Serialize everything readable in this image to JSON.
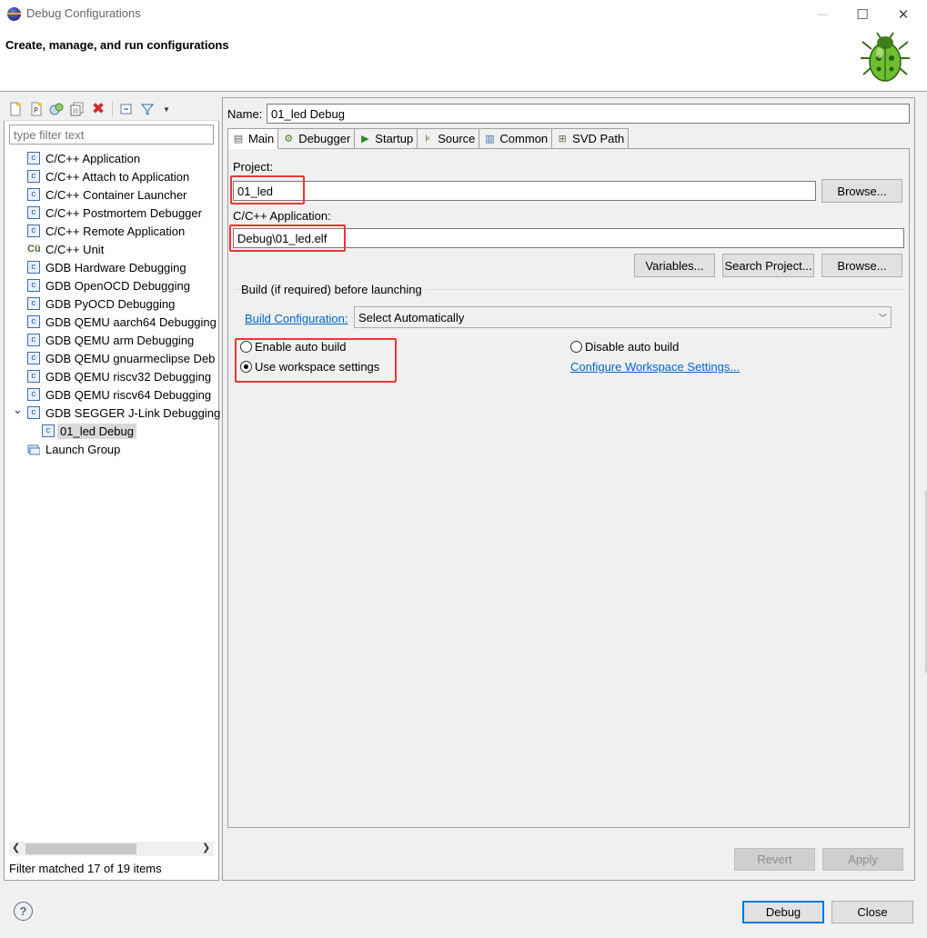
{
  "window": {
    "title": "Debug Configurations",
    "header": "Create, manage, and run configurations",
    "minimize": "—",
    "maximize": "☐",
    "close": "✕"
  },
  "toolbar": {
    "icons": [
      "new-configuration-icon",
      "new-prototype-icon",
      "export-icon",
      "duplicate-icon",
      "delete-icon",
      "collapse-all-icon",
      "filter-icon",
      "view-menu-icon"
    ]
  },
  "filter": {
    "placeholder": "type filter text",
    "status": "Filter matched 17 of 19 items"
  },
  "tree": {
    "items": [
      {
        "label": "C/C++ Application",
        "icon": "c"
      },
      {
        "label": "C/C++ Attach to Application",
        "icon": "c"
      },
      {
        "label": "C/C++ Container Launcher",
        "icon": "c"
      },
      {
        "label": "C/C++ Postmortem Debugger",
        "icon": "c"
      },
      {
        "label": "C/C++ Remote Application",
        "icon": "c"
      },
      {
        "label": "C/C++ Unit",
        "icon": "cu"
      },
      {
        "label": "GDB Hardware Debugging",
        "icon": "c"
      },
      {
        "label": "GDB OpenOCD Debugging",
        "icon": "c"
      },
      {
        "label": "GDB PyOCD Debugging",
        "icon": "c"
      },
      {
        "label": "GDB QEMU aarch64 Debugging",
        "icon": "c"
      },
      {
        "label": "GDB QEMU arm Debugging",
        "icon": "c"
      },
      {
        "label": "GDB QEMU gnuarmeclipse Deb",
        "icon": "c"
      },
      {
        "label": "GDB QEMU riscv32 Debugging",
        "icon": "c"
      },
      {
        "label": "GDB QEMU riscv64 Debugging",
        "icon": "c"
      },
      {
        "label": "GDB SEGGER J-Link Debugging",
        "icon": "c"
      },
      {
        "label": "01_led Debug",
        "icon": "c"
      },
      {
        "label": "Launch Group",
        "icon": "group"
      }
    ]
  },
  "name": {
    "label": "Name:",
    "value": "01_led Debug"
  },
  "tabs": [
    {
      "label": "Main",
      "icon": "main-tab-icon"
    },
    {
      "label": "Debugger",
      "icon": "debugger-tab-icon"
    },
    {
      "label": "Startup",
      "icon": "startup-tab-icon"
    },
    {
      "label": "Source",
      "icon": "source-tab-icon"
    },
    {
      "label": "Common",
      "icon": "common-tab-icon"
    },
    {
      "label": "SVD Path",
      "icon": "svd-path-tab-icon"
    }
  ],
  "main": {
    "project_label": "Project:",
    "project_value": "01_led",
    "browse1": "Browse...",
    "app_label": "C/C++ Application:",
    "app_value": "Debug\\01_led.elf",
    "variables": "Variables...",
    "search_project": "Search Project...",
    "browse2": "Browse...",
    "build_group": "Build (if required) before launching",
    "build_config_link": "Build Configuration:",
    "build_config_value": "Select Automatically",
    "enable_auto_build": "Enable auto build",
    "disable_auto_build": "Disable auto build",
    "use_workspace": "Use workspace settings",
    "configure_workspace": "Configure Workspace Settings...",
    "selected_build_option": "Use workspace settings"
  },
  "buttons": {
    "revert": "Revert",
    "apply": "Apply",
    "debug": "Debug",
    "close": "Close",
    "help": "?"
  },
  "colors": {
    "highlight": "#e53935",
    "link": "#0066cc",
    "default_button_border": "#0078d7"
  }
}
